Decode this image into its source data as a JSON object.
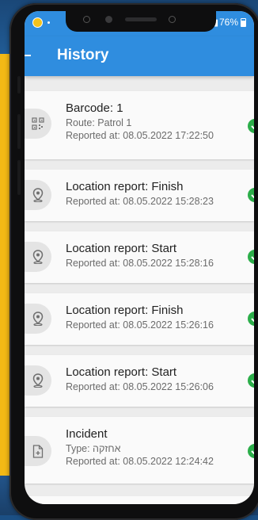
{
  "status_bar": {
    "battery": "76%"
  },
  "header": {
    "title": "History"
  },
  "colors": {
    "app_bar": "#2f8ddf",
    "check": "#2cae4a",
    "background_accent": "#f3b915"
  },
  "items": [
    {
      "icon": "qr-code-icon",
      "title": "Barcode: 1",
      "lines": [
        "Route: Patrol 1",
        "Reported at: 08.05.2022 17:22:50"
      ],
      "status_icon": "check-circle-icon"
    },
    {
      "icon": "location-pin-icon",
      "title": "Location report: Finish",
      "lines": [
        "Reported at: 08.05.2022 15:28:23"
      ],
      "status_icon": "check-circle-icon"
    },
    {
      "icon": "location-pin-icon",
      "title": "Location report: Start",
      "lines": [
        "Reported at: 08.05.2022 15:28:16"
      ],
      "status_icon": "check-circle-icon"
    },
    {
      "icon": "location-pin-icon",
      "title": "Location report: Finish",
      "lines": [
        "Reported at: 08.05.2022 15:26:16"
      ],
      "status_icon": "check-circle-icon"
    },
    {
      "icon": "location-pin-icon",
      "title": "Location report: Start",
      "lines": [
        "Reported at: 08.05.2022 15:26:06"
      ],
      "status_icon": "check-circle-icon"
    },
    {
      "icon": "document-add-icon",
      "title": "Incident",
      "lines": [
        "Type: אחזקה",
        "Reported at: 08.05.2022 12:24:42"
      ],
      "status_icon": "check-circle-icon"
    }
  ]
}
